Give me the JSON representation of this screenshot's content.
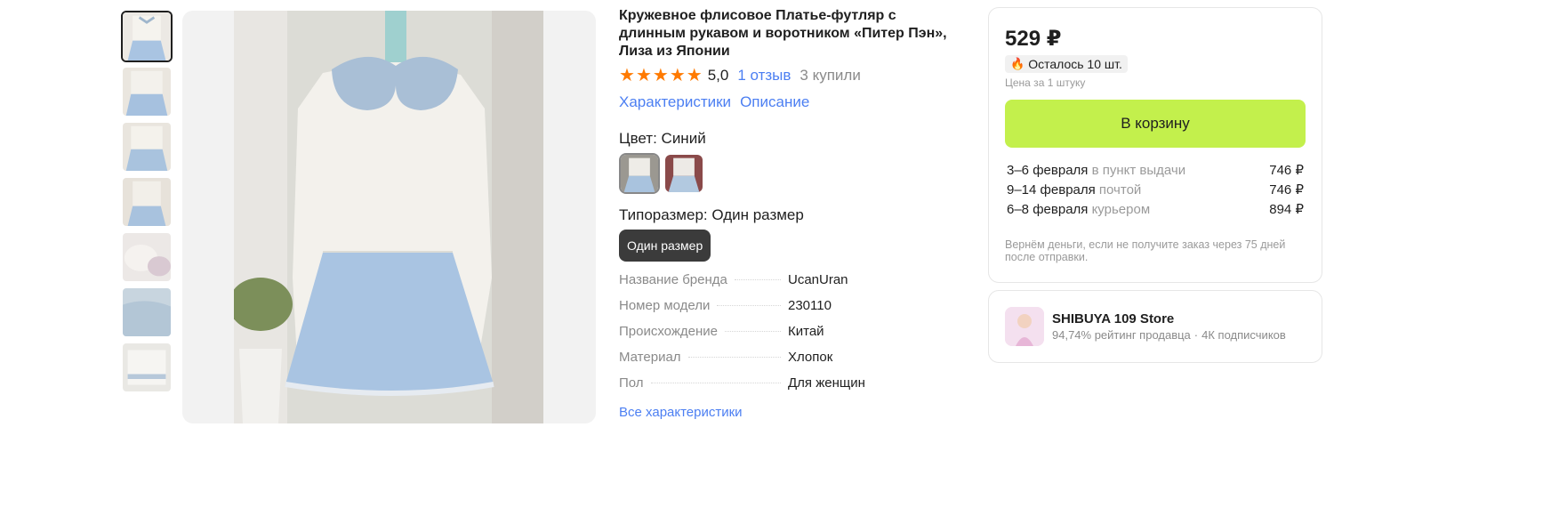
{
  "product": {
    "title": "Кружевное флисовое Платье-футляр с длинным рукавом и воротником «Питер Пэн», Лиза из Японии",
    "rating": "5,0",
    "stars": 5,
    "reviews": "1 отзыв",
    "bought": "3 купили",
    "tabs": [
      "Характеристики",
      "Описание"
    ]
  },
  "color": {
    "label": "Цвет: Синий"
  },
  "size": {
    "label": "Типоразмер: Один размер",
    "button": "Один размер"
  },
  "specs": [
    {
      "k": "Название бренда",
      "v": "UcanUran"
    },
    {
      "k": "Номер модели",
      "v": "230110"
    },
    {
      "k": "Происхождение",
      "v": "Китай"
    },
    {
      "k": "Материал",
      "v": "Хлопок"
    },
    {
      "k": "Пол",
      "v": "Для женщин"
    }
  ],
  "all_specs": "Все характеристики",
  "buy": {
    "price": "529 ₽",
    "stock": "Осталось 10 шт.",
    "unit": "Цена за 1 штуку",
    "cart": "В корзину",
    "delivery": [
      {
        "date": "3–6 февраля",
        "method": "в пункт выдачи",
        "price": "746 ₽"
      },
      {
        "date": "9–14 февраля",
        "method": "почтой",
        "price": "746 ₽"
      },
      {
        "date": "6–8 февраля",
        "method": "курьером",
        "price": "894 ₽"
      }
    ],
    "refund": "Вернём деньги, если не получите заказ через 75 дней после отправки."
  },
  "seller": {
    "name": "SHIBUYA 109 Store",
    "rating": "94,74% рейтинг продавца",
    "subs": "4К подписчиков"
  },
  "icons": {
    "star": "star-icon",
    "fire": "fire-icon"
  },
  "colors": {
    "accent_link": "#4c7ff2",
    "cart": "#c3f04c",
    "star": "#ff7a00"
  }
}
